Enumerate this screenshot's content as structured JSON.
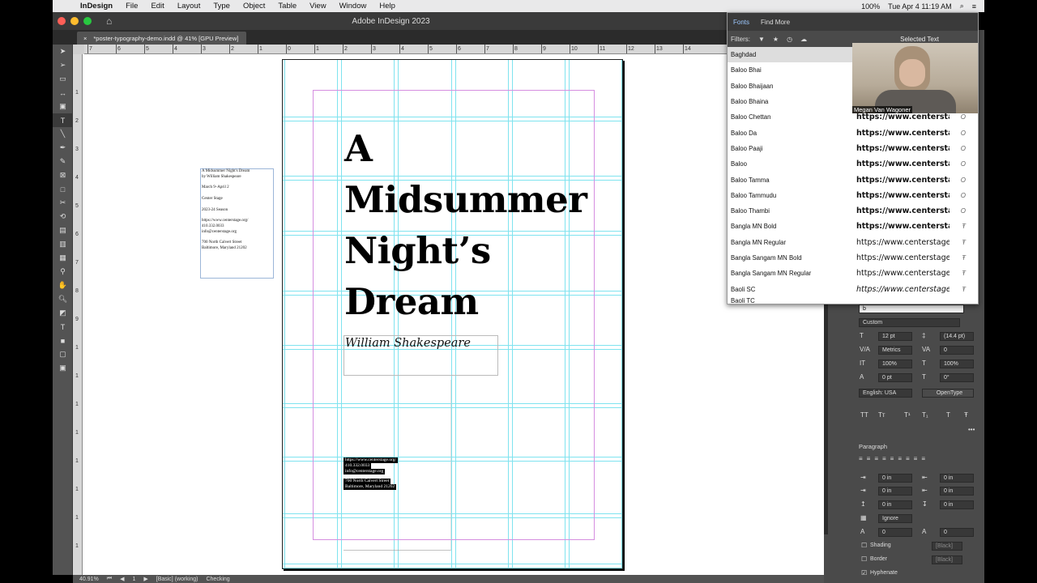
{
  "menubar": {
    "app": "InDesign",
    "items": [
      "File",
      "Edit",
      "Layout",
      "Type",
      "Object",
      "Table",
      "View",
      "Window",
      "Help"
    ],
    "battery": "100%",
    "clock": "Tue Apr 4  11:19 AM"
  },
  "window": {
    "title": "Adobe InDesign 2023"
  },
  "document_tab": {
    "label": "*poster-typography-demo.indd @ 41% [GPU Preview]"
  },
  "ruler": {
    "h_labels": [
      "7",
      "6",
      "5",
      "4",
      "3",
      "2",
      "1",
      "0",
      "1",
      "2",
      "3",
      "4",
      "5",
      "6",
      "7",
      "8",
      "9",
      "10",
      "11",
      "12",
      "13",
      "14"
    ],
    "v_labels": [
      "1",
      "2",
      "3",
      "4",
      "5",
      "6",
      "7",
      "8",
      "9",
      "1",
      "1",
      "1",
      "1",
      "1",
      "1",
      "1",
      "1"
    ]
  },
  "poster": {
    "title_lines": [
      "A",
      "Midsummer",
      "Night’s",
      "Dream"
    ],
    "author": "William Shakespeare",
    "contact_block_1": [
      "https://www.centerstage.org/",
      "410.332.0033",
      "info@centerstage.org"
    ],
    "contact_block_2": [
      "700 North Calvert Street",
      "Baltimore, Maryland 21202"
    ]
  },
  "pasteboard_text": {
    "lines": [
      "A Midsummer Night's Dream",
      "by William Shakespeare",
      "",
      "March 9–April 2",
      "",
      "Center Stage",
      "",
      "2023-24 Season",
      "",
      "https://www.centerstage.org/",
      "410.332.0033",
      "info@centerstage.org",
      "",
      "700 North Calvert Street",
      "Baltimore, Maryland 21202"
    ]
  },
  "statusbar": {
    "zoom": "40.91%",
    "page": "1",
    "style": "[Basic] (working)",
    "preflight": "Checking"
  },
  "font_menu": {
    "tabs": [
      "Fonts",
      "Find More"
    ],
    "filters_label": "Filters:",
    "selected_text_label": "Selected Text",
    "sample_text": "https://www.centerstage",
    "fonts": [
      "Baghdad",
      "Baloo Bhai",
      "Baloo Bhaijaan",
      "Baloo Bhaina",
      "Baloo Chettan",
      "Baloo Da",
      "Baloo Paaji",
      "Baloo",
      "Baloo Tamma",
      "Baloo Tammudu",
      "Baloo Thambi",
      "Bangla MN Bold",
      "Bangla MN Regular",
      "Bangla Sangam MN Bold",
      "Bangla Sangam MN Regular",
      "Baoli SC",
      "Baoli TC"
    ]
  },
  "video": {
    "name": "Megan Van Wagoner"
  },
  "character_panel": {
    "search_value": "b",
    "style": "Custom",
    "size": "12 pt",
    "leading": "(14.4 pt)",
    "kerning": "Metrics",
    "tracking": "0",
    "vscale": "100%",
    "hscale": "100%",
    "baseline": "0 pt",
    "skew": "0°",
    "language": "English: USA",
    "opentype": "OpenType",
    "caps": [
      "TT",
      "Tт",
      "T¹",
      "T₁",
      "T",
      "Ŧ"
    ]
  },
  "paragraph_panel": {
    "title": "Paragraph",
    "left_indent": "0 in",
    "right_indent": "0 in",
    "first_indent": "0 in",
    "last_indent": "0 in",
    "space_before": "0 in",
    "space_after": "0 in",
    "grid": "Ignore",
    "drop_lines": "0",
    "drop_chars": "0",
    "shading": "Shading",
    "border": "Border",
    "hyphenate": "Hyphenate",
    "swatch_shading": "[Black]",
    "swatch_border": "[Black]"
  },
  "colors": {
    "guide": "#7fe3ef",
    "margin": "#d58ee0",
    "chrome": "#535353"
  }
}
